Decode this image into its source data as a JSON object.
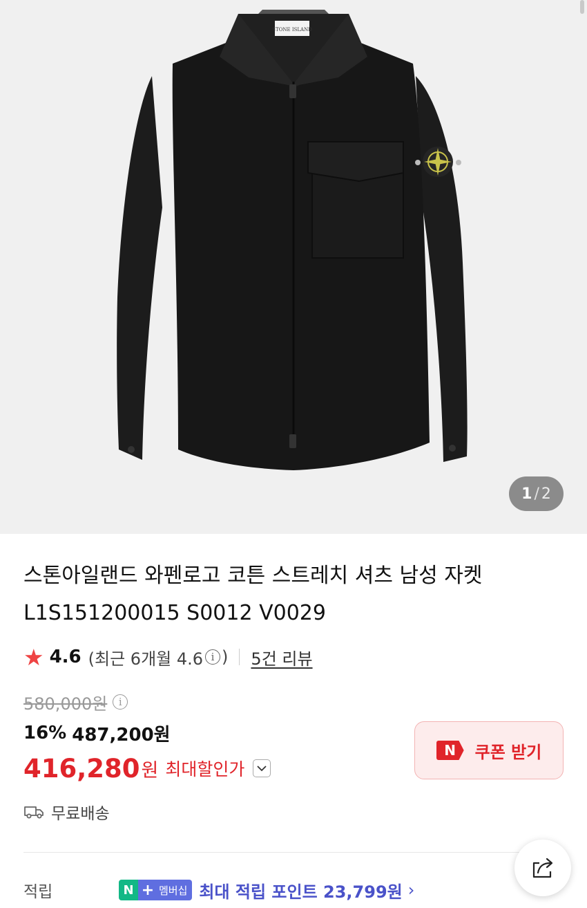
{
  "product": {
    "image_counter": {
      "current": "1",
      "separator": "/",
      "total": "2"
    },
    "title_line1": "스톤아일랜드 와펜로고 코튼 스트레치 셔츠 남성 자켓",
    "title_line2": "L1S151200015 S0012 V0029",
    "brand_tag_text": "STONE ISLAND"
  },
  "rating": {
    "star_icon": "star-icon",
    "score": "4.6",
    "recent_open": "(최근 6개월 4.6",
    "recent_close": ")",
    "reviews_link": "5건 리뷰"
  },
  "price": {
    "original": "580,000원",
    "discount_percent": "16%",
    "discounted": "487,200원",
    "max_discount_amount": "416,280",
    "max_discount_unit": "원",
    "max_discount_label": "최대할인가"
  },
  "coupon": {
    "badge": "N",
    "label": "쿠폰 받기"
  },
  "shipping": {
    "icon": "truck-icon",
    "label": "무료배송"
  },
  "points": {
    "label": "적립",
    "badge_n": "N",
    "badge_plus": "+",
    "badge_text": "멤버십",
    "text": "최대 적립 포인트 23,799원",
    "arrow": "›"
  },
  "colors": {
    "accent_red": "#e0242a",
    "points_blue": "#4a52c9",
    "naver_green": "#12b886"
  }
}
